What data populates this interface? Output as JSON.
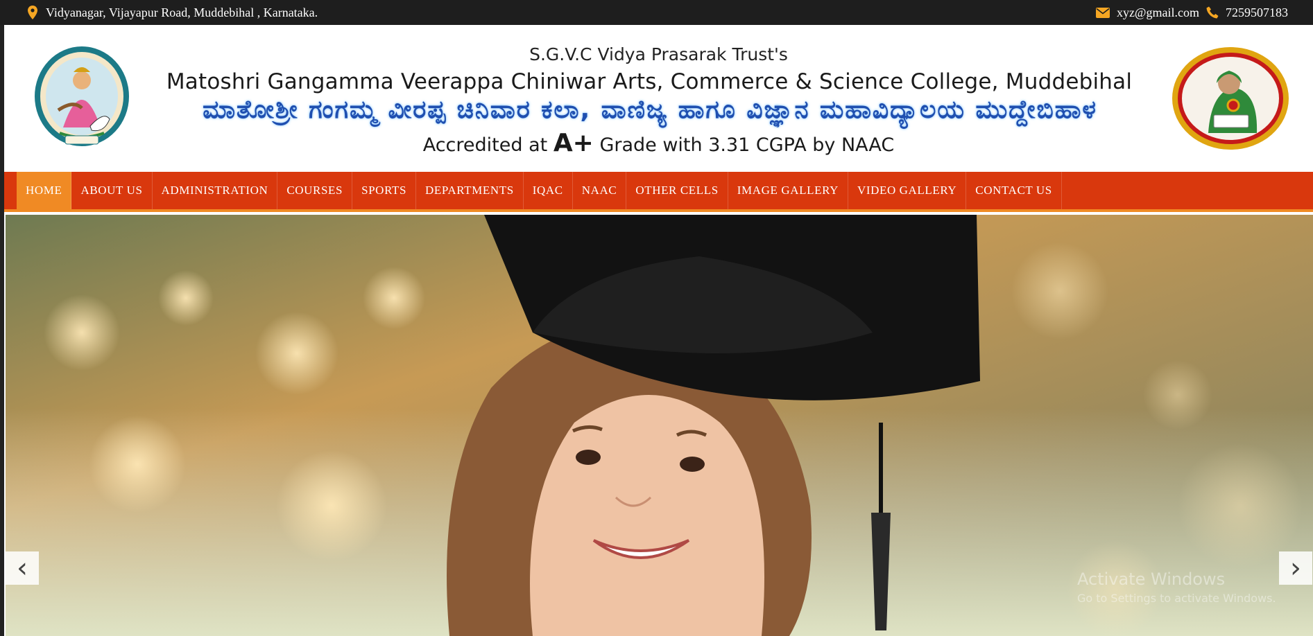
{
  "topbar": {
    "address": "Vidyanagar, Vijayapur Road, Muddebihal , Karnataka.",
    "email": "xyz@gmail.com",
    "phone": "7259507183",
    "icons": {
      "location": "map-pin-icon",
      "email": "envelope-icon",
      "phone": "phone-icon"
    },
    "icon_color": "#f5a623"
  },
  "header": {
    "trust": "S.G.V.C Vidya Prasarak Trust's",
    "college_en": "Matoshri Gangamma Veerappa Chiniwar Arts, Commerce & Science College, Muddebihal",
    "college_kn": "ಮಾತೋಶ್ರೀ ಗಂಗಮ್ಮ ವೀರಪ್ಪ ಚಿನಿವಾರ ಕಲಾ, ವಾಣಿಜ್ಯ ಹಾಗೂ ವಿಜ್ಞಾನ ಮಹಾವಿದ್ಯಾಲಯ ಮುದ್ದೇಬಿಹಾಳ",
    "accredit_prefix": "Accredited at",
    "accredit_grade": "A+",
    "accredit_suffix": "Grade with 3.31 CGPA by NAAC"
  },
  "nav": {
    "items": [
      "HOME",
      "ABOUT US",
      "ADMINISTRATION",
      "COURSES",
      "SPORTS",
      "DEPARTMENTS",
      "IQAC",
      "NAAC",
      "OTHER CELLS",
      "IMAGE GALLERY",
      "VIDEO GALLERY",
      "CONTACT US"
    ],
    "active": "HOME",
    "bar_color": "#d9380d",
    "active_color": "#f08a24"
  },
  "slider": {
    "prev_icon": "chevron-left-icon",
    "next_icon": "chevron-right-icon",
    "prev_glyph": "‹",
    "next_glyph": "›"
  },
  "watermark": {
    "line1": "Activate Windows",
    "line2": "Go to Settings to activate Windows."
  }
}
